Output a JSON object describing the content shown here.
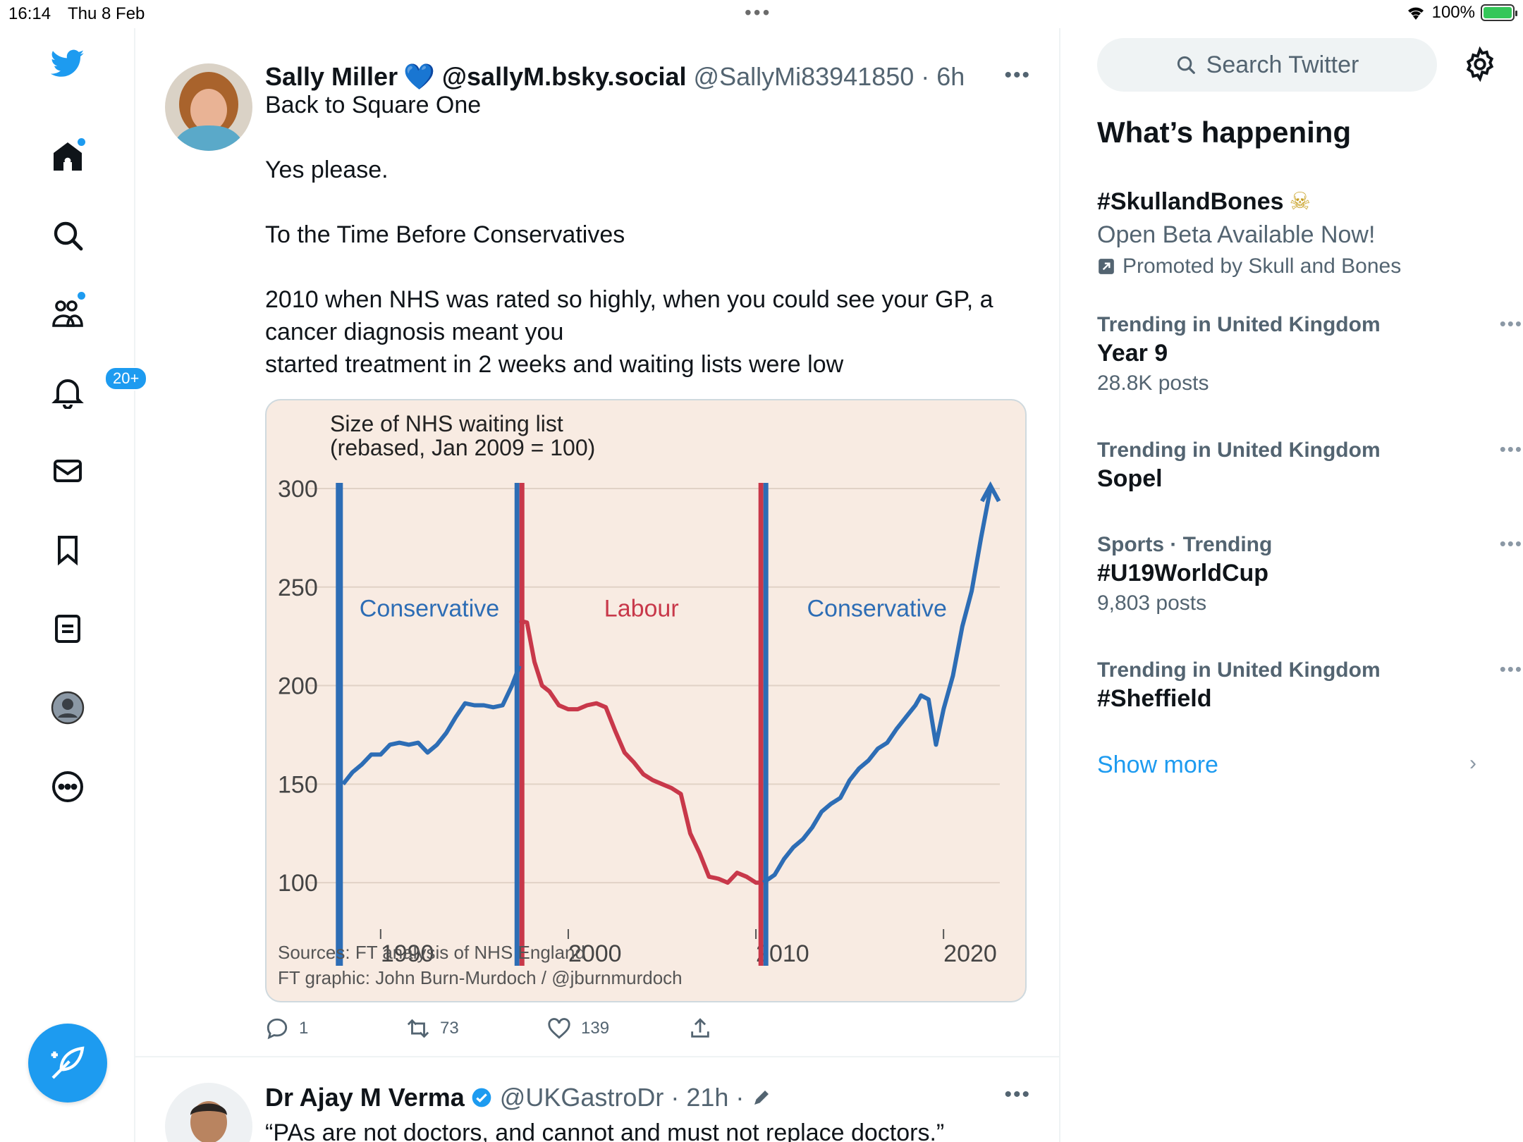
{
  "status_bar": {
    "time": "16:14",
    "date": "Thu 8 Feb",
    "battery": "100%"
  },
  "nav": {
    "notifications_count": "20+"
  },
  "tweet1": {
    "display_name": "Sally Miller",
    "name_emoji": "💙",
    "alt_handle": "@sallyM.bsky.social",
    "handle_time": "@SallyMi83941850 · 6h",
    "lines": [
      "Back to Square One",
      "",
      "Yes please.",
      "",
      "To the Time Before Conservatives",
      "",
      "2010 when NHS was rated so highly, when you could see your GP, a",
      "cancer diagnosis meant you",
      "started treatment in 2 weeks and waiting lists were low"
    ],
    "replies": "1",
    "retweets": "73",
    "likes": "139"
  },
  "chart_data": {
    "type": "line",
    "title": "Size of NHS waiting list",
    "subtitle": "(rebased, Jan 2009 = 100)",
    "xlabel": "",
    "ylabel": "",
    "ylim": [
      80,
      300
    ],
    "xlim": [
      1987,
      2023
    ],
    "y_ticks": [
      "300",
      "250",
      "200",
      "150",
      "100"
    ],
    "x_ticks": [
      "1990",
      "2000",
      "2010",
      "2020"
    ],
    "periods": [
      {
        "label": "Conservative",
        "color": "#2d6db5",
        "start": 1987.8,
        "end": 1997.4
      },
      {
        "label": "Labour",
        "color": "#c8384a",
        "start": 1997.4,
        "end": 2010.4
      },
      {
        "label": "Conservative",
        "color": "#2d6db5",
        "start": 2010.4,
        "end": 2023
      }
    ],
    "series": [
      {
        "segment": "conservative-1",
        "color": "#2d6db5",
        "x": [
          1988.0,
          1988.5,
          1989.0,
          1989.5,
          1990.0,
          1990.5,
          1991.0,
          1991.5,
          1992.0,
          1992.5,
          1993.0,
          1993.5,
          1994.0,
          1994.5,
          1995.0,
          1995.5,
          1996.0,
          1996.5,
          1997.0,
          1997.4
        ],
        "y": [
          150,
          156,
          160,
          165,
          165,
          170,
          171,
          170,
          171,
          166,
          170,
          176,
          184,
          191,
          190,
          190,
          189,
          190,
          200,
          210
        ]
      },
      {
        "segment": "labour",
        "color": "#c8384a",
        "x": [
          1997.4,
          1997.8,
          1998.2,
          1998.6,
          1999.0,
          1999.5,
          2000.0,
          2000.5,
          2001.0,
          2001.5,
          2002.0,
          2002.5,
          2003.0,
          2003.5,
          2004.0,
          2004.5,
          2005.0,
          2005.5,
          2006.0,
          2006.5,
          2007.0,
          2007.5,
          2008.0,
          2008.5,
          2009.0,
          2009.5,
          2010.0,
          2010.4
        ],
        "y": [
          233,
          232,
          212,
          200,
          197,
          190,
          188,
          188,
          190,
          191,
          189,
          177,
          166,
          161,
          155,
          152,
          150,
          148,
          145,
          125,
          115,
          103,
          102,
          100,
          105,
          103,
          100,
          100
        ]
      },
      {
        "segment": "conservative-2",
        "color": "#2d6db5",
        "x": [
          2010.4,
          2011.0,
          2011.5,
          2012.0,
          2012.5,
          2013.0,
          2013.5,
          2014.0,
          2014.5,
          2015.0,
          2015.5,
          2016.0,
          2016.5,
          2017.0,
          2017.5,
          2018.0,
          2018.5,
          2018.8,
          2019.2,
          2019.6,
          2020.0,
          2020.5,
          2021.0,
          2021.5,
          2022.0,
          2022.5
        ],
        "y": [
          100,
          104,
          112,
          118,
          122,
          128,
          136,
          140,
          143,
          152,
          158,
          162,
          168,
          171,
          178,
          184,
          190,
          195,
          193,
          170,
          188,
          205,
          230,
          248,
          275,
          300
        ]
      }
    ],
    "sources": [
      "Sources: FT analysis of NHS England",
      "FT graphic: John Burn-Murdoch / @jburnmurdoch"
    ]
  },
  "tweet2": {
    "display_name": "Dr Ajay M Verma",
    "handle_time": "@UKGastroDr · 21h ·",
    "text": "“PAs are not doctors, and cannot and must not replace doctors.”"
  },
  "sidebar": {
    "search_placeholder": "Search Twitter",
    "section_title": "What’s happening",
    "promoted": {
      "title": "#SkullandBones",
      "emoji": "☠",
      "subtitle": "Open Beta Available Now!",
      "by": "Promoted by Skull and Bones"
    },
    "trends": [
      {
        "meta": "Trending in United Kingdom",
        "title": "Year 9",
        "posts": "28.8K posts"
      },
      {
        "meta": "Trending in United Kingdom",
        "title": "Sopel",
        "posts": ""
      },
      {
        "meta": "Sports · Trending",
        "title": "#U19WorldCup",
        "posts": "9,803 posts"
      },
      {
        "meta": "Trending in United Kingdom",
        "title": "#Sheffield",
        "posts": ""
      }
    ],
    "show_more": "Show more"
  },
  "colors": {
    "accent": "#1d9bf0",
    "muted": "#536471",
    "conservative": "#2d6db5",
    "labour": "#c8384a",
    "chart_bg": "#f8ebe2"
  }
}
